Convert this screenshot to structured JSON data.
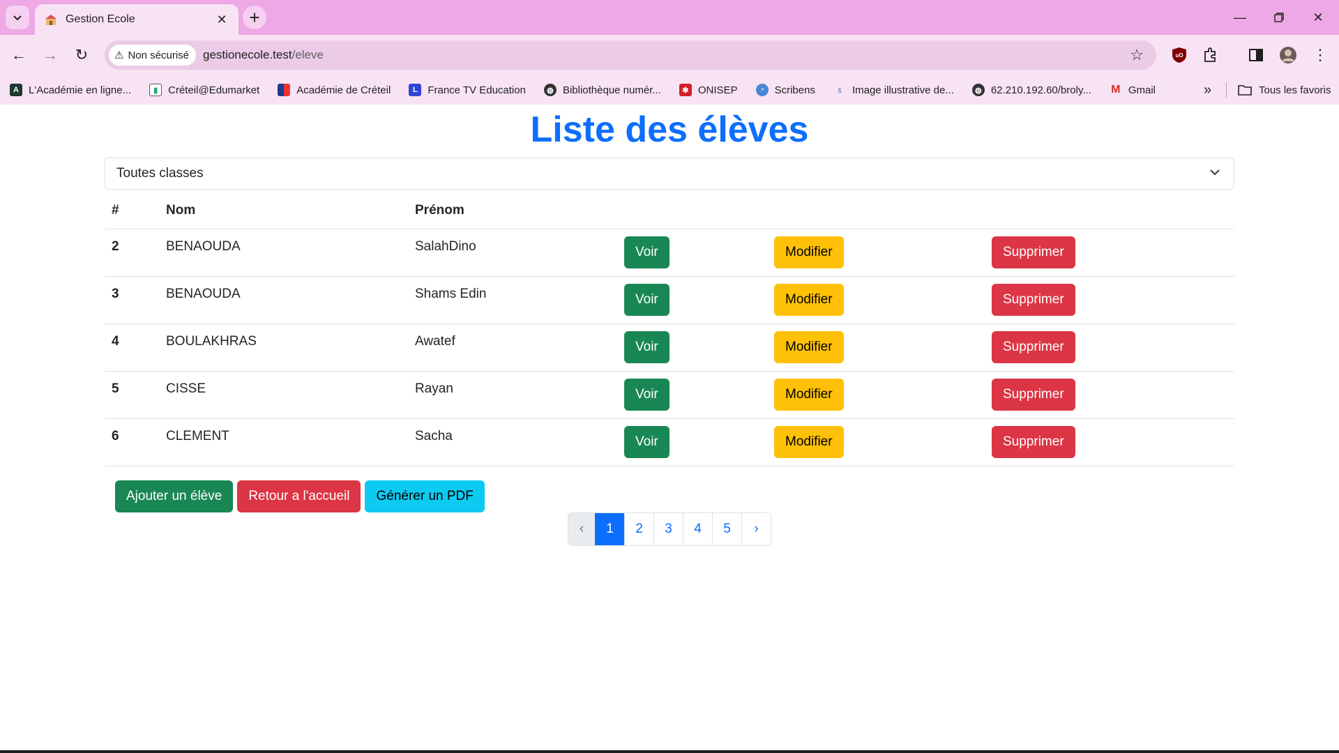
{
  "browser": {
    "tab_title": "Gestion Ecole",
    "security_label": "Non sécurisé",
    "url_host": "gestionecole.test",
    "url_path": "/eleve",
    "bookmarks": [
      "L'Académie en ligne...",
      "Créteil@Edumarket",
      "Académie de Créteil",
      "France TV Education",
      "Bibliothèque numér...",
      "ONISEP",
      "Scribens",
      "Image illustrative de...",
      "62.210.192.60/broly...",
      "Gmail"
    ],
    "all_bookmarks_label": "Tous les favoris",
    "more_bookmarks": "»"
  },
  "page": {
    "title": "Liste des élèves",
    "class_select_value": "Toutes classes",
    "table_headers": {
      "id": "#",
      "nom": "Nom",
      "prenom": "Prénom"
    },
    "rows": [
      {
        "id": "2",
        "nom": "BENAOUDA",
        "prenom": "SalahDino"
      },
      {
        "id": "3",
        "nom": "BENAOUDA",
        "prenom": "Shams Edin"
      },
      {
        "id": "4",
        "nom": "BOULAKHRAS",
        "prenom": "Awatef"
      },
      {
        "id": "5",
        "nom": "CISSE",
        "prenom": "Rayan"
      },
      {
        "id": "6",
        "nom": "CLEMENT",
        "prenom": "Sacha"
      }
    ],
    "row_buttons": {
      "view": "Voir",
      "edit": "Modifier",
      "delete": "Supprimer"
    },
    "actions": {
      "add": "Ajouter un élève",
      "home": "Retour a l'accueil",
      "pdf": "Générer un PDF"
    },
    "pagination": {
      "prev": "‹",
      "pages": [
        "1",
        "2",
        "3",
        "4",
        "5"
      ],
      "next": "›",
      "current": "1"
    }
  },
  "colors": {
    "primary": "#0d6efd",
    "success": "#198754",
    "warning": "#ffc107",
    "danger": "#dc3545",
    "info": "#0dcaf0",
    "chrome_tab_bar": "#eda8e5"
  }
}
